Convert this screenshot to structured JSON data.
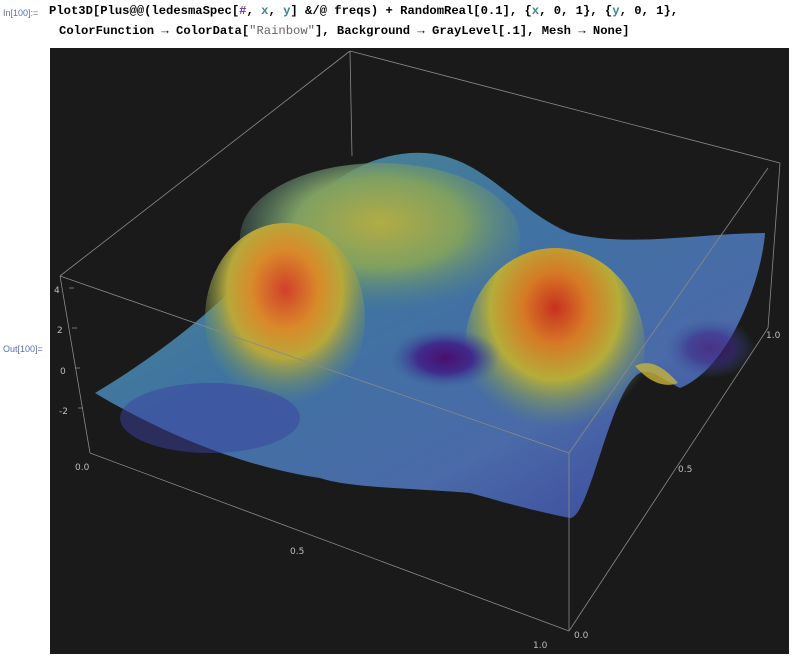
{
  "cell": {
    "in_label": "In[100]:=",
    "out_label": "Out[100]=",
    "line1": {
      "a": "Plot3D[Plus@@(ledesmaSpec[",
      "hash": "#",
      "b": ", ",
      "x": "x",
      "c": ", ",
      "y": "y",
      "d": "] &/@ freqs) + RandomReal[0.1], {",
      "x2": "x",
      "e": ", 0, 1}, {",
      "y2": "y",
      "f": ", 0, 1},"
    },
    "line2": {
      "a": "ColorFunction → ColorData[",
      "str": "\"Rainbow\"",
      "b": "], Background → GrayLevel[.1], Mesh → None]"
    }
  },
  "plot": {
    "background": "#1a1a1a",
    "box_color": "#8a8a8a",
    "z_ticks": [
      "4",
      "2",
      "0",
      "-2"
    ],
    "x_ticks": [
      "0.0",
      "0.5",
      "1.0"
    ],
    "y_ticks": [
      "0.0",
      "0.5",
      "1.0"
    ]
  }
}
